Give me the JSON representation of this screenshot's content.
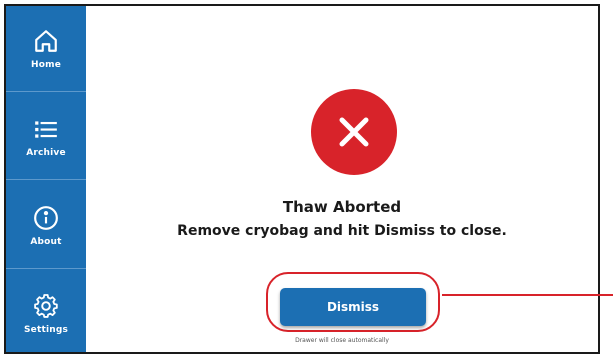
{
  "sidebar": {
    "items": [
      {
        "label": "Home",
        "icon": "home-icon"
      },
      {
        "label": "Archive",
        "icon": "list-icon"
      },
      {
        "label": "About",
        "icon": "info-icon"
      },
      {
        "label": "Settings",
        "icon": "gear-icon"
      }
    ]
  },
  "dialog": {
    "icon": "error-x-icon",
    "title": "Thaw Aborted",
    "message": "Remove cryobag and hit Dismiss to close.",
    "dismiss_label": "Dismiss",
    "note": "Drawer will close automatically"
  },
  "colors": {
    "sidebar": "#1c6fb3",
    "error": "#d8232a",
    "button": "#1c6fb3",
    "highlight": "#d8232a"
  }
}
